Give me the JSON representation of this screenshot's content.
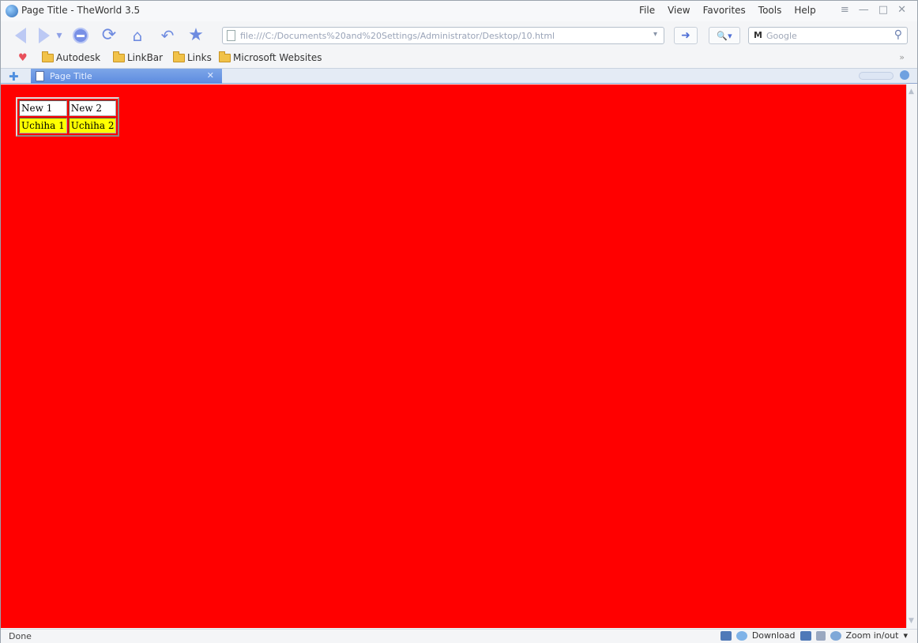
{
  "window": {
    "title": "Page Title - TheWorld 3.5"
  },
  "menu": {
    "items": [
      "File",
      "View",
      "Favorites",
      "Tools",
      "Help"
    ]
  },
  "address": {
    "url": "file:///C:/Documents%20and%20Settings/Administrator/Desktop/10.html"
  },
  "search": {
    "placeholder": "Google",
    "provider": "M"
  },
  "bookmarks": {
    "items": [
      "Autodesk",
      "LinkBar",
      "Links",
      "Microsoft Websites"
    ]
  },
  "tabs": [
    {
      "label": "Page Title"
    }
  ],
  "page": {
    "background": "#ff0000",
    "table": [
      [
        {
          "text": "New 1",
          "bg": "#ffffff"
        },
        {
          "text": "New 2",
          "bg": "#ffffff"
        }
      ],
      [
        {
          "text": "Uchiha 1",
          "bg": "#ffff00"
        },
        {
          "text": "Uchiha 2",
          "bg": "#ffff00"
        }
      ]
    ]
  },
  "status": {
    "text": "Done",
    "download_label": "Download",
    "zoom_label": "Zoom in/out"
  }
}
